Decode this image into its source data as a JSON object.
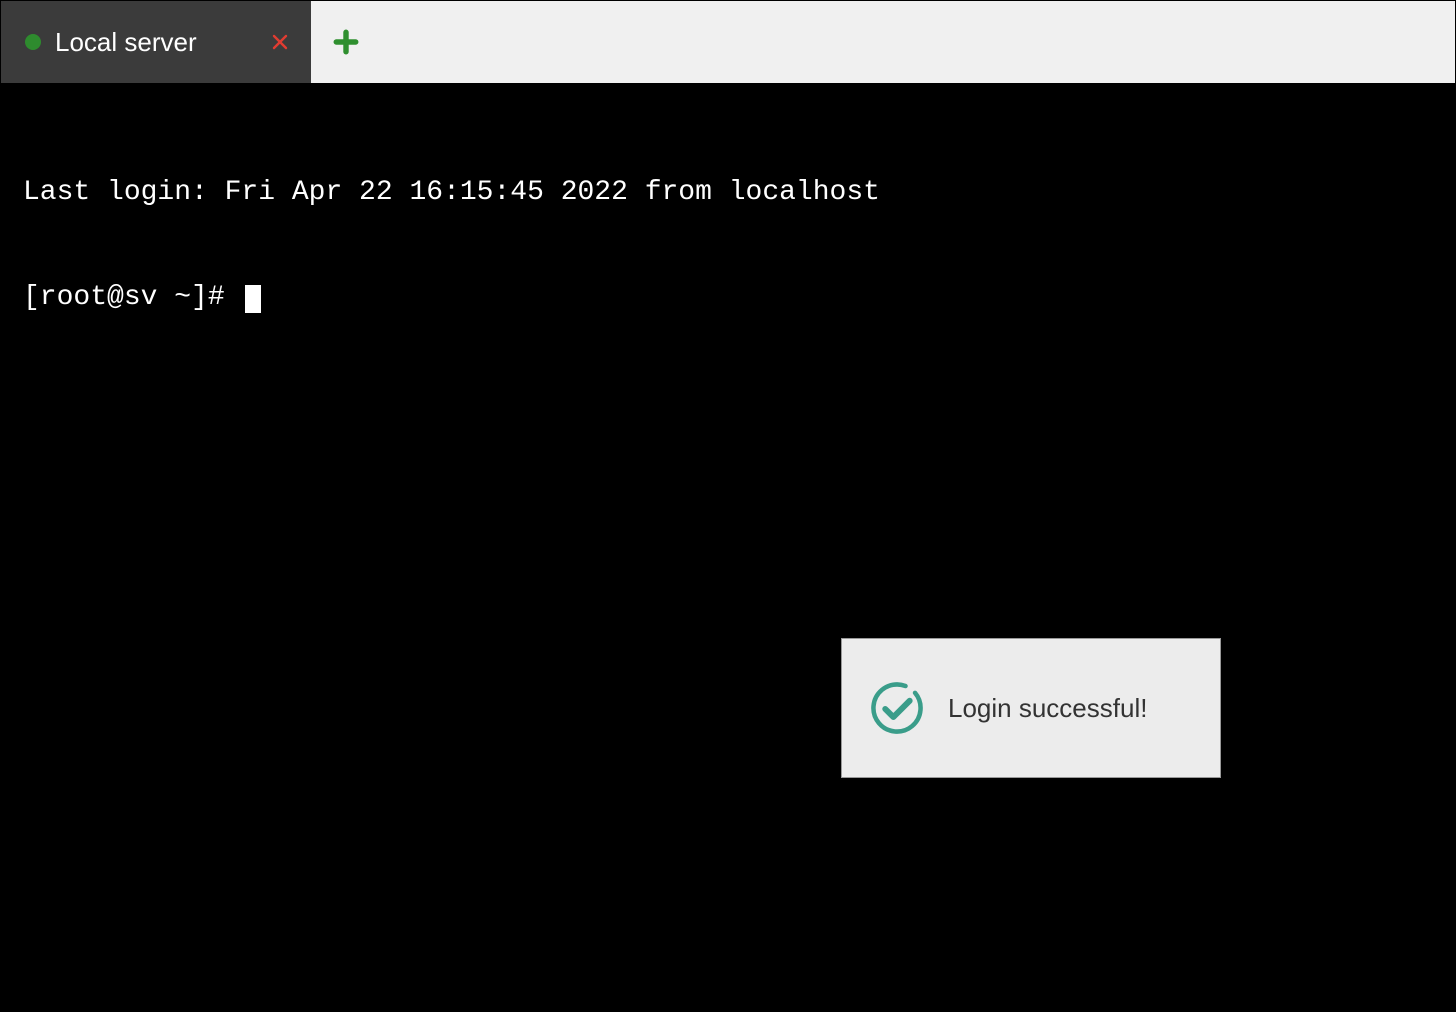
{
  "tabbar": {
    "tabs": [
      {
        "title": "Local server",
        "status": "connected"
      }
    ]
  },
  "terminal": {
    "lines": [
      "Last login: Fri Apr 22 16:15:45 2022 from localhost"
    ],
    "prompt": "[root@sv ~]# "
  },
  "toast": {
    "message": "Login successful!"
  },
  "colors": {
    "tab_bg": "#3b3b3b",
    "status_dot": "#2e8b2e",
    "close_x": "#e03c31",
    "plus": "#2f8f2f",
    "toast_check": "#3a9d8a"
  }
}
